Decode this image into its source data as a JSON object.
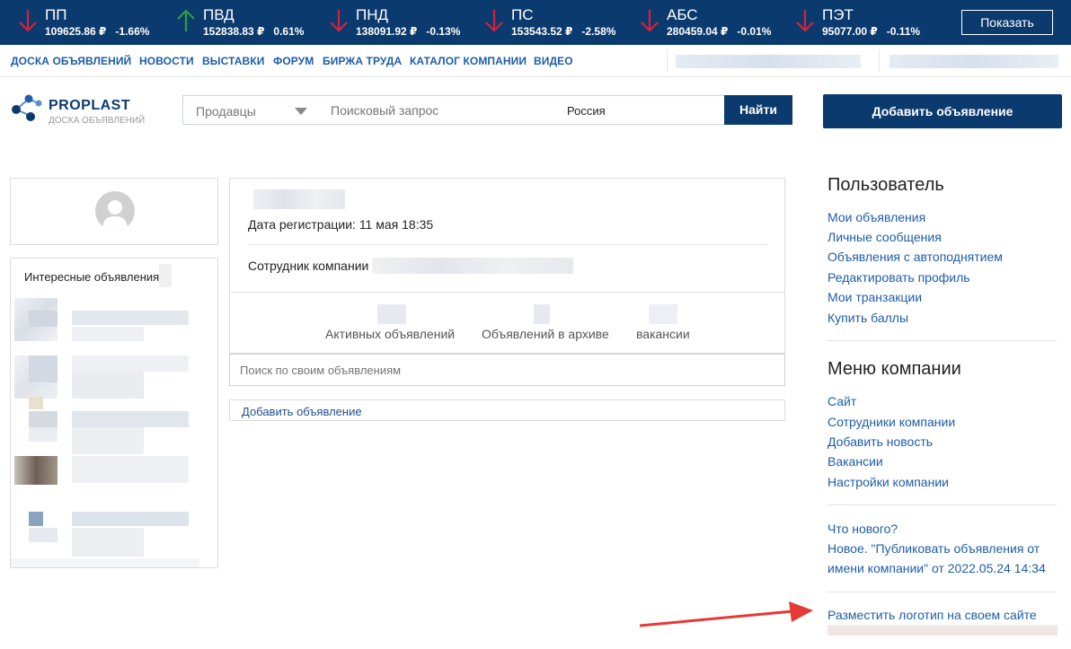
{
  "ticker": {
    "items": [
      {
        "name": "ПП",
        "price": "109625.86 ₽",
        "change": "-1.66%",
        "direction": "down"
      },
      {
        "name": "ПВД",
        "price": "152838.83 ₽",
        "change": "0.61%",
        "direction": "up"
      },
      {
        "name": "ПНД",
        "price": "138091.92 ₽",
        "change": "-0.13%",
        "direction": "down"
      },
      {
        "name": "ПС",
        "price": "153543.52 ₽",
        "change": "-2.58%",
        "direction": "down"
      },
      {
        "name": "АБС",
        "price": "280459.04 ₽",
        "change": "-0.01%",
        "direction": "down"
      },
      {
        "name": "ПЭТ",
        "price": "95077.00 ₽",
        "change": "-0.11%",
        "direction": "down"
      }
    ],
    "show_label": "Показать",
    "up_color": "#2e9e3e",
    "down_color": "#d8203a"
  },
  "nav": {
    "items": [
      "ДОСКА ОБЪЯВЛЕНИЙ",
      "НОВОСТИ",
      "ВЫСТАВКИ",
      "ФОРУМ",
      "БИРЖА ТРУДА",
      "КАТАЛОГ КОМПАНИИ",
      "ВИДЕО"
    ]
  },
  "header": {
    "logo_title": "PROPLAST",
    "logo_subtitle": "ДОСКА ОБЪЯВЛЕНИЙ",
    "category_select": "Продавцы",
    "search_placeholder": "Поисковый запрос",
    "region": "Россия",
    "find_label": "Найти",
    "add_ad_label": "Добавить объявление"
  },
  "left": {
    "interesting_title": "Интересные объявления"
  },
  "profile": {
    "reg_date": "Дата регистрации: 11 мая 18:35",
    "employee_label": "Сотрудник компании",
    "stats": [
      {
        "label": "Активных объявлений"
      },
      {
        "label": "Объявлений в архиве"
      },
      {
        "label": "вакансии"
      }
    ],
    "own_search_placeholder": "Поиск по своим объявлениям",
    "add_ad_link": "Добавить объявление"
  },
  "right": {
    "user_heading": "Пользователь",
    "user_links": [
      "Мои объявления",
      "Личные сообщения",
      "Объявления с автоподнятием",
      "Редактировать профиль",
      "Мои транзакции",
      "Купить баллы"
    ],
    "company_heading": "Меню компании",
    "company_links": [
      "Сайт",
      "Сотрудники компании",
      "Добавить новость",
      "Вакансии",
      "Настройки компании"
    ],
    "whats_new": "Что нового?",
    "news_line1": "Новое. \"Публиковать объявления от",
    "news_line2": "имени компании\" от 2022.05.24 14:34",
    "place_logo": "Разместить логотип на своем сайте"
  },
  "colors": {
    "brand": "#0b3a6e",
    "link": "#1e5da8",
    "annotation_arrow": "#e53935"
  }
}
